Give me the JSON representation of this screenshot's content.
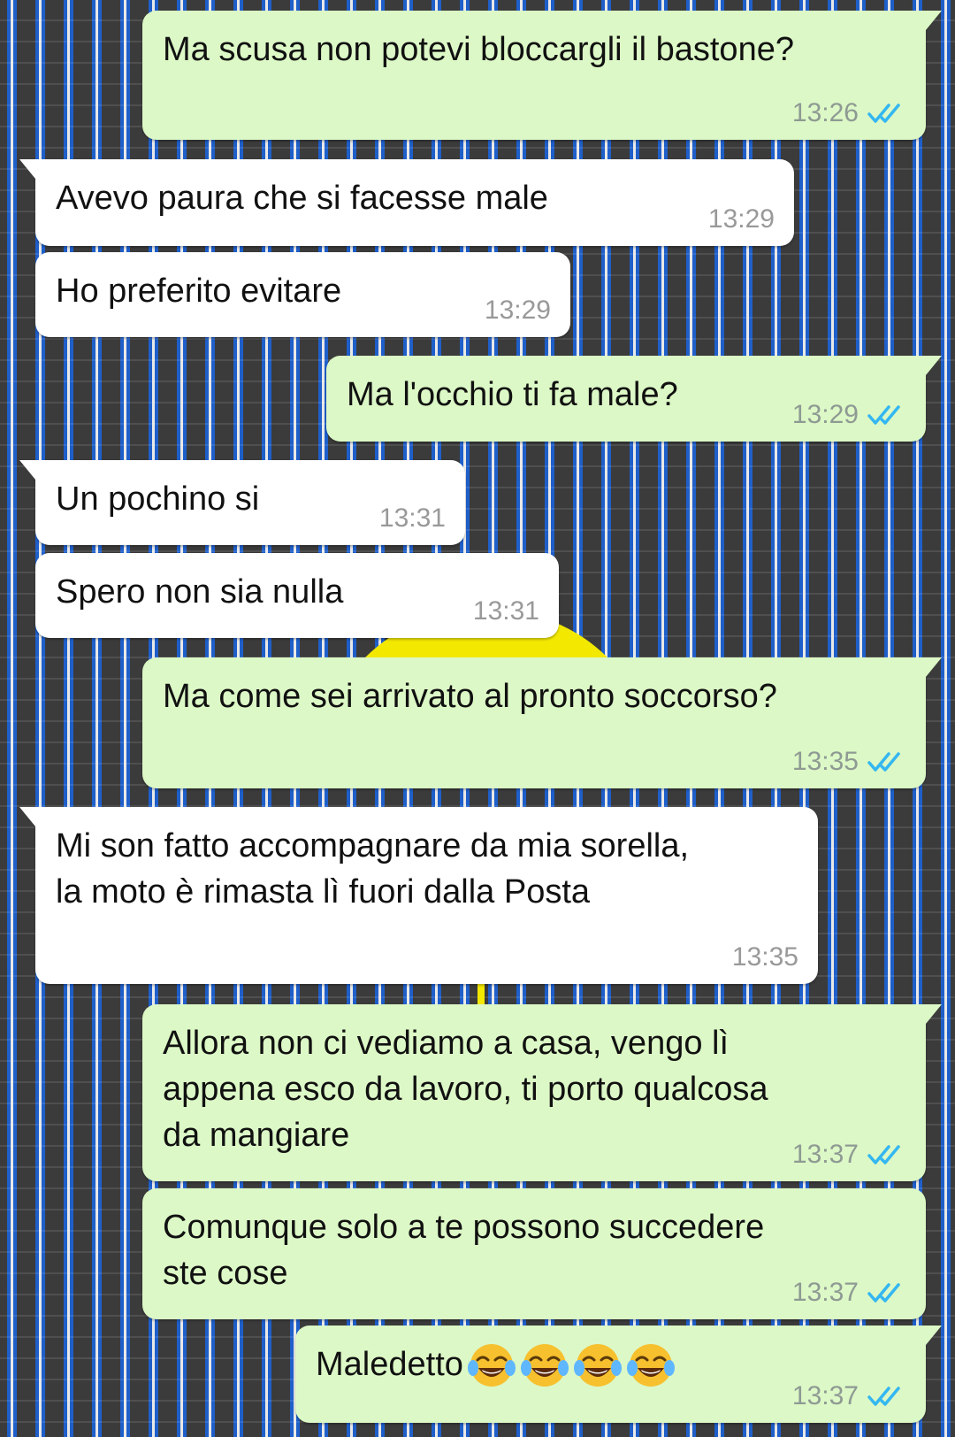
{
  "colors": {
    "incoming_bubble": "#ffffff",
    "outgoing_bubble": "#dcf8c6",
    "read_ticks": "#34b7f1",
    "timestamp": "#8e9a93"
  },
  "messages": [
    {
      "direction": "out",
      "text": "Ma scusa non potevi bloccargli il bastone?",
      "time": "13:26",
      "status": "read"
    },
    {
      "direction": "in",
      "text": "Avevo paura che si facesse male",
      "time": "13:29"
    },
    {
      "direction": "in",
      "text": "Ho preferito evitare",
      "time": "13:29"
    },
    {
      "direction": "out",
      "text": "Ma l'occhio ti fa male?",
      "time": "13:29",
      "status": "read"
    },
    {
      "direction": "in",
      "text": "Un pochino si",
      "time": "13:31"
    },
    {
      "direction": "in",
      "text": "Spero non sia nulla",
      "time": "13:31"
    },
    {
      "direction": "out",
      "text": "Ma come sei arrivato al pronto soccorso?",
      "time": "13:35",
      "status": "read"
    },
    {
      "direction": "in",
      "text": "Mi son fatto accompagnare da mia sorella,\nla moto è rimasta lì fuori dalla Posta",
      "time": "13:35"
    },
    {
      "direction": "out",
      "text": "Allora non ci vediamo a casa, vengo lì\nappena esco da lavoro, ti porto qualcosa\nda mangiare",
      "time": "13:37",
      "status": "read"
    },
    {
      "direction": "out",
      "text": "Comunque solo a te possono succedere\nste cose",
      "time": "13:37",
      "status": "read"
    },
    {
      "direction": "out",
      "text": "Maledetto",
      "emoji": [
        "tears-of-joy",
        "tears-of-joy",
        "tears-of-joy",
        "tears-of-joy"
      ],
      "time": "13:37",
      "status": "read"
    }
  ]
}
